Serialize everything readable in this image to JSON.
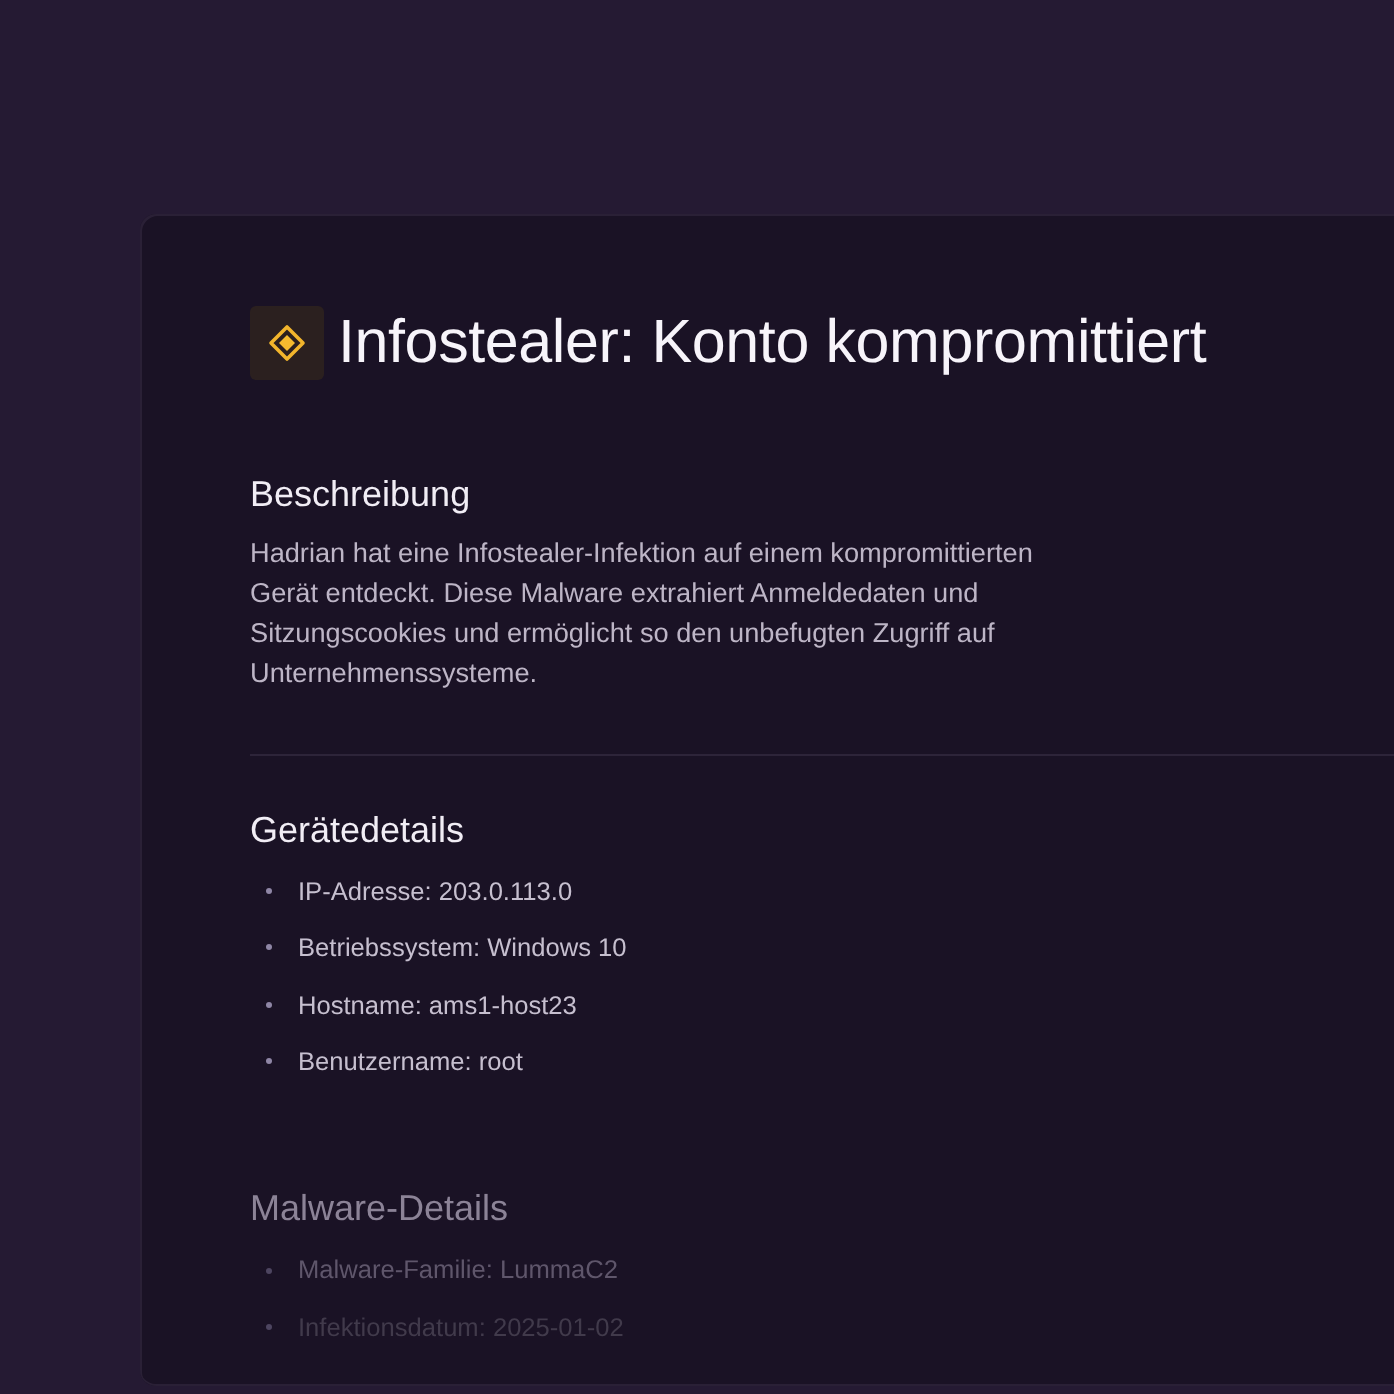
{
  "title": {
    "text": "Infostealer: Konto kompromittiert"
  },
  "sections": [
    {
      "kind": "text",
      "heading": "Beschreibung",
      "text": "Hadrian hat eine Infostealer-Infektion auf einem kompromittierten Gerät entdeckt. Diese Malware extrahiert Anmeldedaten und Sitzungscookies und ermöglicht so den unbefugten Zugriff auf Unternehmenssysteme."
    },
    {
      "kind": "list",
      "heading": "Gerätedetails",
      "items": [
        "IP-Adresse: 203.0.113.0",
        "Betriebssystem: Windows 10",
        "Hostname: ams1-host23",
        "Benutzername: root"
      ]
    },
    {
      "kind": "list",
      "heading": "Malware-Details",
      "items": [
        "Malware-Familie: LummaC2",
        "Infektionsdatum: 2025-01-02"
      ]
    }
  ]
}
